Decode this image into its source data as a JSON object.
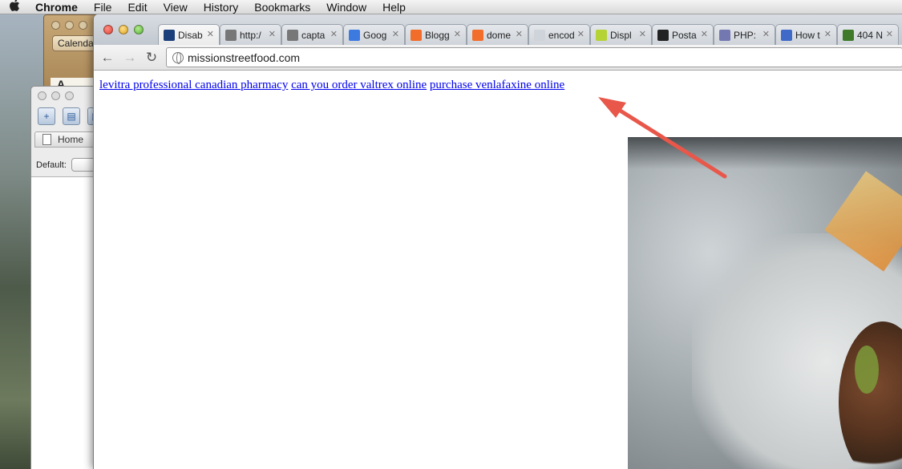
{
  "menubar": {
    "apple": "",
    "app_name": "Chrome",
    "items": [
      "File",
      "Edit",
      "View",
      "History",
      "Bookmarks",
      "Window",
      "Help"
    ]
  },
  "calendar_window": {
    "button_label": "Calenda",
    "partial_text": "A"
  },
  "db_window": {
    "tab_label": "Home",
    "default_label": "Default:"
  },
  "browser": {
    "tabs": [
      {
        "label": "Disab",
        "favicon": "moon-icon",
        "color": "#1b3f7a"
      },
      {
        "label": "http:/",
        "favicon": "globe-icon",
        "color": "#777777"
      },
      {
        "label": "capta",
        "favicon": "globe-icon",
        "color": "#777777"
      },
      {
        "label": "Goog",
        "favicon": "google-icon",
        "color": "#3d7ae0"
      },
      {
        "label": "Blogg",
        "favicon": "blogger-icon",
        "color": "#f26c2a"
      },
      {
        "label": "dome",
        "favicon": "blogger-icon",
        "color": "#f26c2a"
      },
      {
        "label": "encod",
        "favicon": "blank-icon",
        "color": "#cfd4da"
      },
      {
        "label": "Displ",
        "favicon": "cf-icon",
        "color": "#b5d334"
      },
      {
        "label": "Posta",
        "favicon": "postal-icon",
        "color": "#222222"
      },
      {
        "label": "PHP:",
        "favicon": "php-icon",
        "color": "#7478b0"
      },
      {
        "label": "How t",
        "favicon": "how-icon",
        "color": "#3f6ac7"
      },
      {
        "label": "404 N",
        "favicon": "check-icon",
        "color": "#3f7a2a"
      }
    ],
    "url": "missionstreetfood.com"
  },
  "page": {
    "links": [
      "levitra professional canadian pharmacy",
      "can you order valtrex online",
      "purchase venlafaxine online"
    ]
  },
  "annotation_color": "#e8574a"
}
